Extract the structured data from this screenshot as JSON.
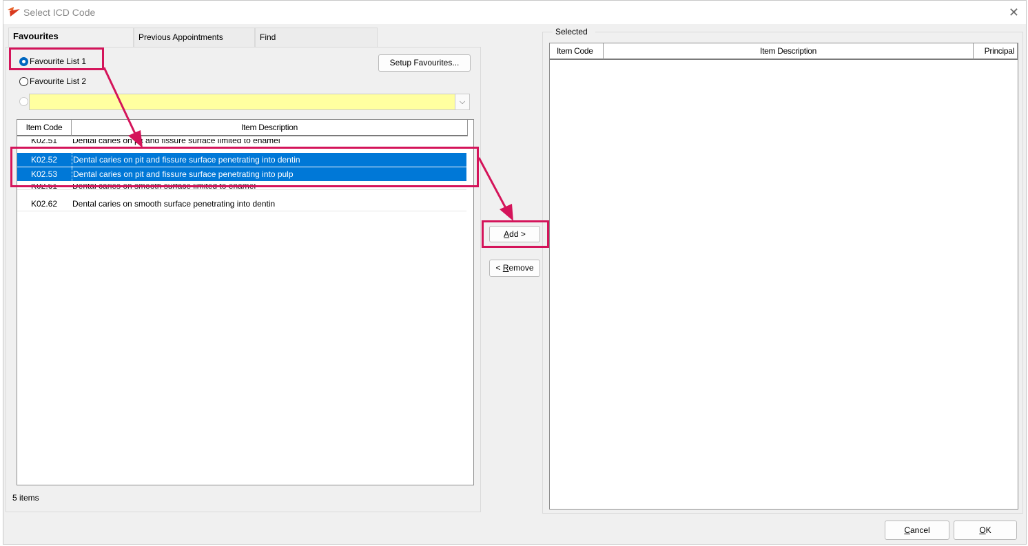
{
  "window": {
    "title": "Select ICD Code",
    "close_label": "✕"
  },
  "tabs": [
    "Favourites",
    "Previous Appointments",
    "Find"
  ],
  "favourites": {
    "radio1_label": "Favourite List 1",
    "radio2_label": "Favourite List 2",
    "combo_value": "",
    "combo_arrow": "⌵",
    "setup_button": "Setup Favourites...",
    "columns": [
      "Item Code",
      "Item Description"
    ],
    "rows": [
      {
        "code": "K02.51",
        "desc": "Dental caries on pit and fissure surface limited to enamel",
        "selected": false
      },
      {
        "code": "K02.52",
        "desc": "Dental caries on pit and fissure surface penetrating into dentin",
        "selected": true
      },
      {
        "code": "K02.53",
        "desc": "Dental caries on pit and fissure surface penetrating into pulp",
        "selected": true
      },
      {
        "code": "K02.61",
        "desc": "Dental caries on smooth surface limited to enamel",
        "selected": false
      },
      {
        "code": "K02.62",
        "desc": "Dental caries on smooth surface penetrating into dentin",
        "selected": false
      }
    ],
    "status": "5 items"
  },
  "buttons": {
    "add_prefix": "",
    "add_underline": "A",
    "add_rest": "dd >",
    "remove_prefix": "< ",
    "remove_underline": "R",
    "remove_rest": "emove",
    "cancel_underline": "C",
    "cancel_rest": "ancel",
    "ok_underline": "O",
    "ok_rest": "K"
  },
  "selected": {
    "group_label": "Selected",
    "columns": [
      "Item Code",
      "Item Description",
      "Principal"
    ]
  },
  "colors": {
    "highlight": "#d4145a",
    "selection": "#0078d7",
    "combo_bg": "#ffffa0"
  }
}
